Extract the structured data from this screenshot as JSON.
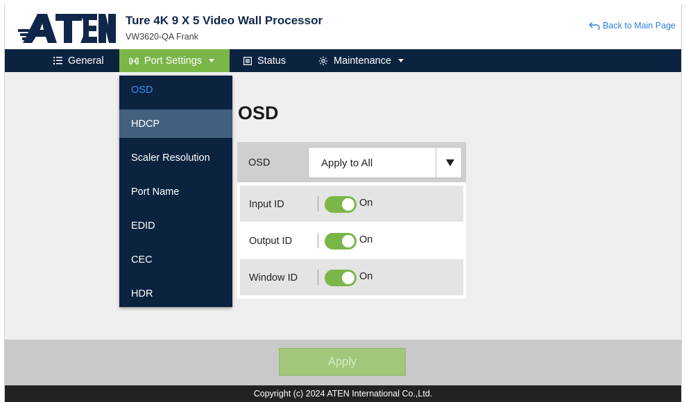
{
  "header": {
    "brand": "ATEN",
    "product_title": "Ture 4K 9 X 5 Video Wall Processor",
    "product_subtitle": "VW3620-QA Frank",
    "back_link": "Back to Main Page"
  },
  "nav": {
    "items": [
      {
        "label": "General",
        "icon": "list-icon"
      },
      {
        "label": "Port Settings",
        "icon": "ports-icon",
        "active": true,
        "has_dropdown": true
      },
      {
        "label": "Status",
        "icon": "status-icon"
      },
      {
        "label": "Maintenance",
        "icon": "gear-icon",
        "has_dropdown": true
      }
    ]
  },
  "dropdown": {
    "items": [
      {
        "label": "OSD",
        "state": "current"
      },
      {
        "label": "HDCP",
        "state": "hover"
      },
      {
        "label": "Scaler Resolution"
      },
      {
        "label": "Port Name"
      },
      {
        "label": "EDID"
      },
      {
        "label": "CEC"
      },
      {
        "label": "HDR"
      }
    ]
  },
  "main": {
    "title": "OSD",
    "osd": {
      "label": "OSD",
      "selected": "Apply to All"
    },
    "toggles": [
      {
        "label": "Input ID",
        "state": "On",
        "on": true
      },
      {
        "label": "Output ID",
        "state": "On",
        "on": true
      },
      {
        "label": "Window ID",
        "state": "On",
        "on": true
      }
    ]
  },
  "footer": {
    "apply_label": "Apply",
    "copyright": "Copyright (c) 2024 ATEN International Co.,Ltd."
  },
  "colors": {
    "navy": "#0c2340",
    "accent_green": "#7ab648",
    "link_blue": "#2f7ed8",
    "menu_current": "#3d8ef0"
  }
}
